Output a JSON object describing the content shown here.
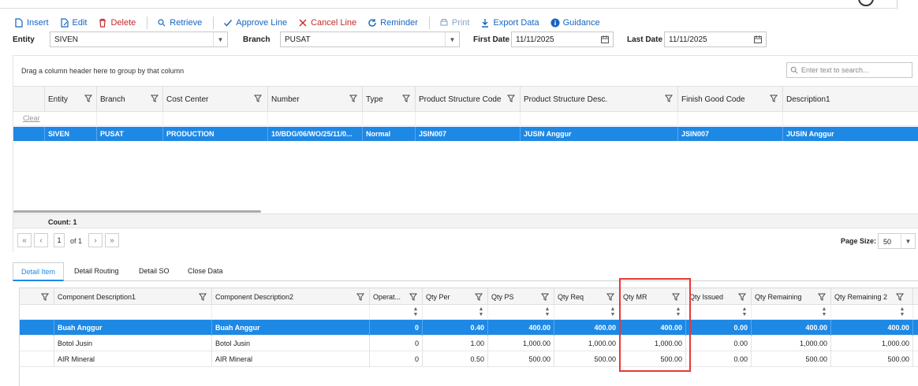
{
  "toolbar": {
    "insert": "Insert",
    "edit": "Edit",
    "delete": "Delete",
    "retrieve": "Retrieve",
    "approve_line": "Approve Line",
    "cancel_line": "Cancel Line",
    "reminder": "Reminder",
    "print": "Print",
    "export_data": "Export Data",
    "guidance": "Guidance"
  },
  "filters": {
    "entity_label": "Entity",
    "entity_value": "SIVEN",
    "branch_label": "Branch",
    "branch_value": "PUSAT",
    "first_date_label": "First Date",
    "first_date_value": "11/11/2025",
    "last_date_label": "Last Date",
    "last_date_value": "11/11/2025"
  },
  "upper_grid": {
    "group_hint": "Drag a column header here to group by that column",
    "search_placeholder": "Enter text to search...",
    "clear_label": "Clear",
    "columns": [
      "Entity",
      "Branch",
      "Cost Center",
      "Number",
      "Type",
      "Product Structure Code",
      "Product Structure Desc.",
      "Finish Good Code",
      "Description1"
    ],
    "rows": [
      [
        "SIVEN",
        "PUSAT",
        "PRODUCTION",
        "10/BDG/06/WO/25/11/0...",
        "Normal",
        "JSIN007",
        "JUSIN Anggur",
        "JSIN007",
        "JUSIN Anggur"
      ]
    ],
    "count_label": "Count: 1"
  },
  "pager": {
    "page": "1",
    "of_label": "of 1",
    "page_size_label": "Page Size:",
    "page_size_value": "50"
  },
  "tabs": [
    "Detail Item",
    "Detail Routing",
    "Detail SO",
    "Close Data"
  ],
  "lower_grid": {
    "columns": [
      "Component Description1",
      "Component Description2",
      "Operat...",
      "Qty Per",
      "Qty PS",
      "Qty Req",
      "Qty MR",
      "Qty Issued",
      "Qty Remaining",
      "Qty Remaining 2"
    ],
    "rows": [
      [
        "Buah Anggur",
        "Buah Anggur",
        "0",
        "0.40",
        "400.00",
        "400.00",
        "400.00",
        "0.00",
        "400.00",
        "400.00"
      ],
      [
        "Botol Jusin",
        "Botol Jusin",
        "0",
        "1.00",
        "1,000.00",
        "1,000.00",
        "1,000.00",
        "0.00",
        "1,000.00",
        "1,000.00"
      ],
      [
        "AIR Mineral",
        "AIR Mineral",
        "0",
        "0.50",
        "500.00",
        "500.00",
        "500.00",
        "0.00",
        "500.00",
        "500.00"
      ]
    ]
  },
  "colors": {
    "accent": "#1e88e5",
    "danger": "#c62828",
    "highlight_box": "#e53935"
  }
}
